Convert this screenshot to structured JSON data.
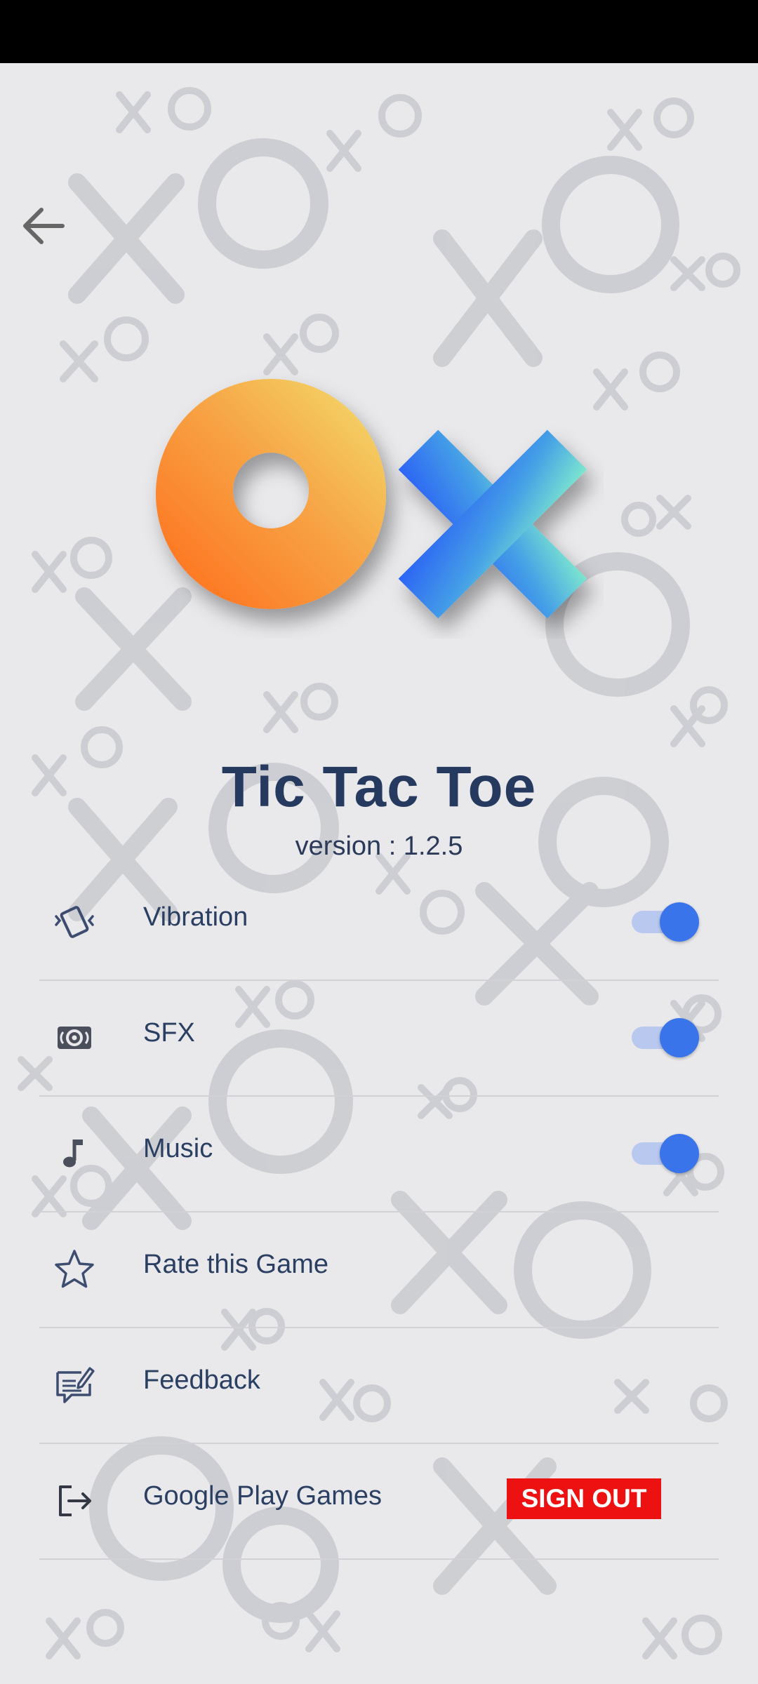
{
  "app": {
    "title": "Tic Tac Toe",
    "version": "version : 1.2.5"
  },
  "colors": {
    "accent": "#3a74ea",
    "title": "#253a5e",
    "sign_out": "#ee1111"
  },
  "settings": [
    {
      "label": "Vibration",
      "icon": "vibration-icon",
      "toggle": true,
      "enabled": true
    },
    {
      "label": "SFX",
      "icon": "speaker-icon",
      "toggle": true,
      "enabled": true
    },
    {
      "label": "Music",
      "icon": "music-note-icon",
      "toggle": true,
      "enabled": true
    },
    {
      "label": "Rate this Game",
      "icon": "star-outline-icon"
    },
    {
      "label": "Feedback",
      "icon": "feedback-icon"
    },
    {
      "label": "Google Play Games",
      "icon": "logout-icon",
      "action_label": "SIGN OUT"
    }
  ]
}
